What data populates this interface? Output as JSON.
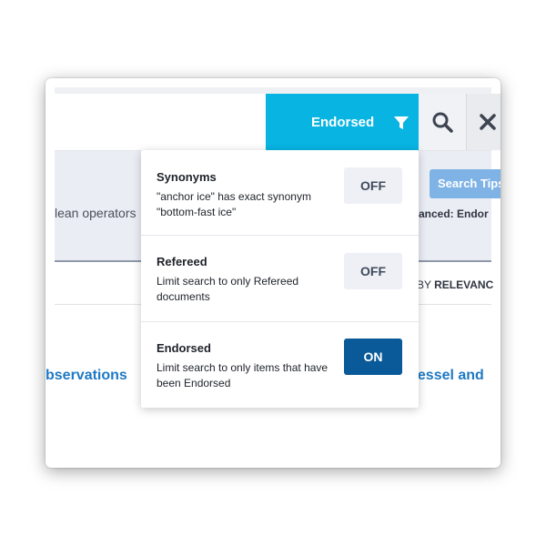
{
  "filter_button": {
    "label": "Endorsed",
    "icon": "filter-icon"
  },
  "search_button": {
    "icon": "search-icon"
  },
  "clear_button": {
    "icon": "close-icon"
  },
  "info_panel": {
    "boolean_text": "lean operators",
    "search_tips_label": "Search Tips",
    "advanced_text": "anced: Endor"
  },
  "sort": {
    "prefix": "BY",
    "value": "RELEVANC"
  },
  "results": {
    "left_title": "bservations",
    "right_title": "vessel and"
  },
  "filters": [
    {
      "title": "Synonyms",
      "description": "\"anchor ice\" has exact synonym \"bottom-fast ice\"",
      "state": "OFF"
    },
    {
      "title": "Refereed",
      "description": "Limit search to only Refereed documents",
      "state": "OFF"
    },
    {
      "title": "Endorsed",
      "description": "Limit search to only items that have been Endorsed",
      "state": "ON"
    }
  ],
  "colors": {
    "filter_button_bg": "#08b4e2",
    "toggle_on_bg": "#0a5998",
    "toggle_off_bg": "#eef0f5",
    "link_color": "#1f79c4"
  }
}
